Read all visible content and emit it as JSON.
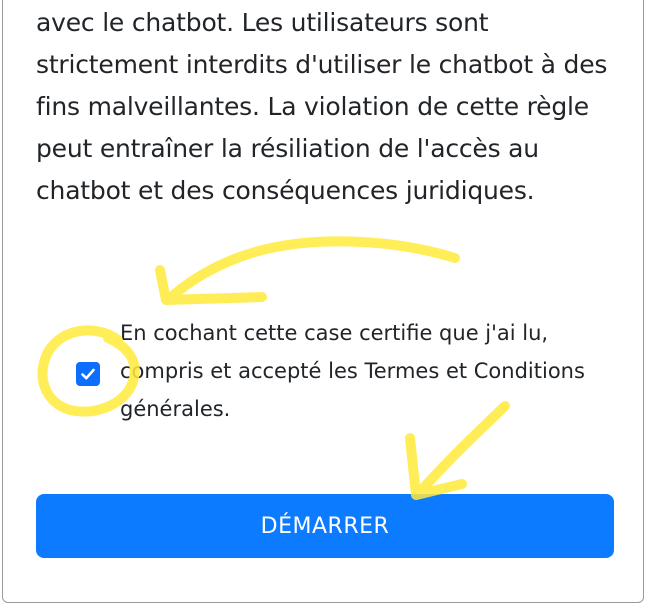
{
  "terms": {
    "paragraph": "avec le chatbot. Les utilisateurs sont strictement interdits d'utiliser le chatbot à des fins malveillantes. La violation de cette règle peut entraîner la résiliation de l'accès au chatbot et des conséquences juridiques."
  },
  "consent": {
    "checked": true,
    "label": "En cochant cette case certifie que j'ai lu, compris et accepté les Termes et Conditions générales."
  },
  "actions": {
    "start_label": "DÉMARRER"
  },
  "colors": {
    "accent": "#0d7bff",
    "annotation": "#ffeb3b",
    "text": "#212529"
  },
  "icons": {
    "checkbox": "check-icon"
  }
}
